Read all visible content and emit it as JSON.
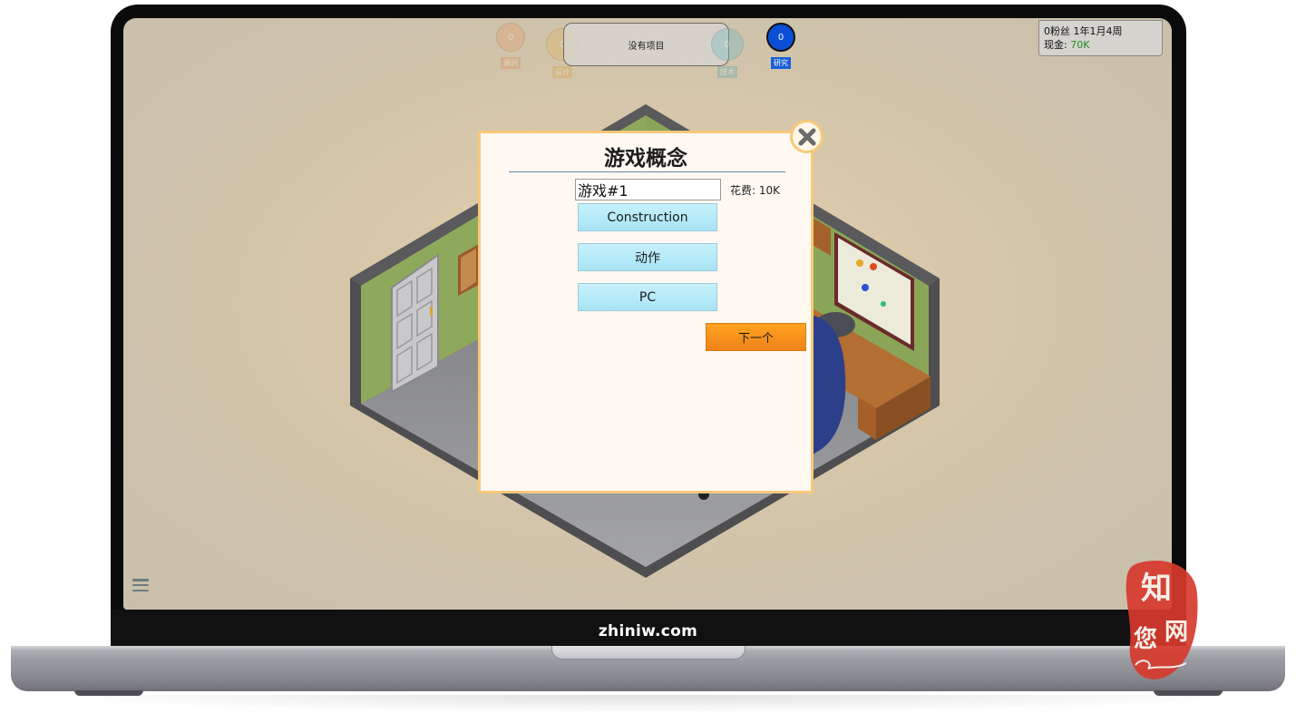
{
  "hud": {
    "stats": [
      {
        "name": "bugs",
        "value": "0",
        "label": "漏洞",
        "color": "#e39b6b",
        "label_bg": "#d88a5a"
      },
      {
        "name": "design",
        "value": "0",
        "label": "设计",
        "color": "#e2b45e",
        "label_bg": "#d6a34a"
      },
      {
        "name": "tech",
        "value": "0",
        "label": "技术",
        "color": "#6fb8c6",
        "label_bg": "#5aa7b5"
      },
      {
        "name": "research",
        "value": "0",
        "label": "研究",
        "color": "#0a4fd6",
        "label_bg": "#1a5fd8"
      }
    ],
    "project_status": "没有项目",
    "info": {
      "fans_date": "0粉丝 1年1月4周",
      "cash_label": "现金:",
      "cash_value": "70K"
    }
  },
  "dialog": {
    "title": "游戏概念",
    "name_value": "游戏#1",
    "cost": "花费: 10K",
    "options": [
      {
        "id": "topic",
        "label": "Construction"
      },
      {
        "id": "genre",
        "label": "动作"
      },
      {
        "id": "platform",
        "label": "PC"
      }
    ],
    "next_label": "下一个"
  },
  "frame": {
    "chin_label": "zhiniw.com"
  },
  "watermark": {
    "badge_text_1": "知",
    "badge_text_2": "网",
    "badge_text_3": "您",
    "badge_color": "#d63a2c"
  }
}
